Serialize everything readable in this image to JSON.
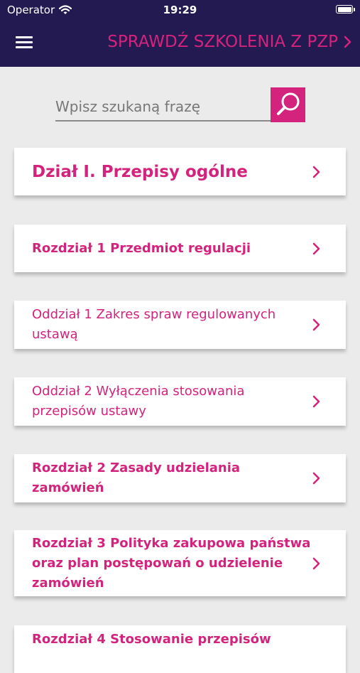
{
  "status_bar": {
    "carrier": "Operator",
    "time": "19:29"
  },
  "header": {
    "link_label": "SPRAWDŹ SZKOLENIA Z PZP"
  },
  "search": {
    "placeholder": "Wpisz szukaną frazę"
  },
  "items": [
    {
      "label": "Dział I. Przepisy ogólne"
    },
    {
      "label": "Rozdział 1 Przedmiot regulacji"
    },
    {
      "label": "Oddział 1 Zakres spraw regulowanych ustawą"
    },
    {
      "label": "Oddział 2 Wyłączenia stosowania przepisów ustawy"
    },
    {
      "label": "Rozdział 2 Zasady udzielania zamówień"
    },
    {
      "label": "Rozdział 3 Polityka zakupowa państwa oraz plan postępowań o udzielenie zamówień"
    },
    {
      "label": "Rozdział 4 Stosowanie przepisów"
    }
  ],
  "colors": {
    "header_bg": "#231a52",
    "accent": "#d4237c",
    "page_bg": "#ebebeb"
  }
}
